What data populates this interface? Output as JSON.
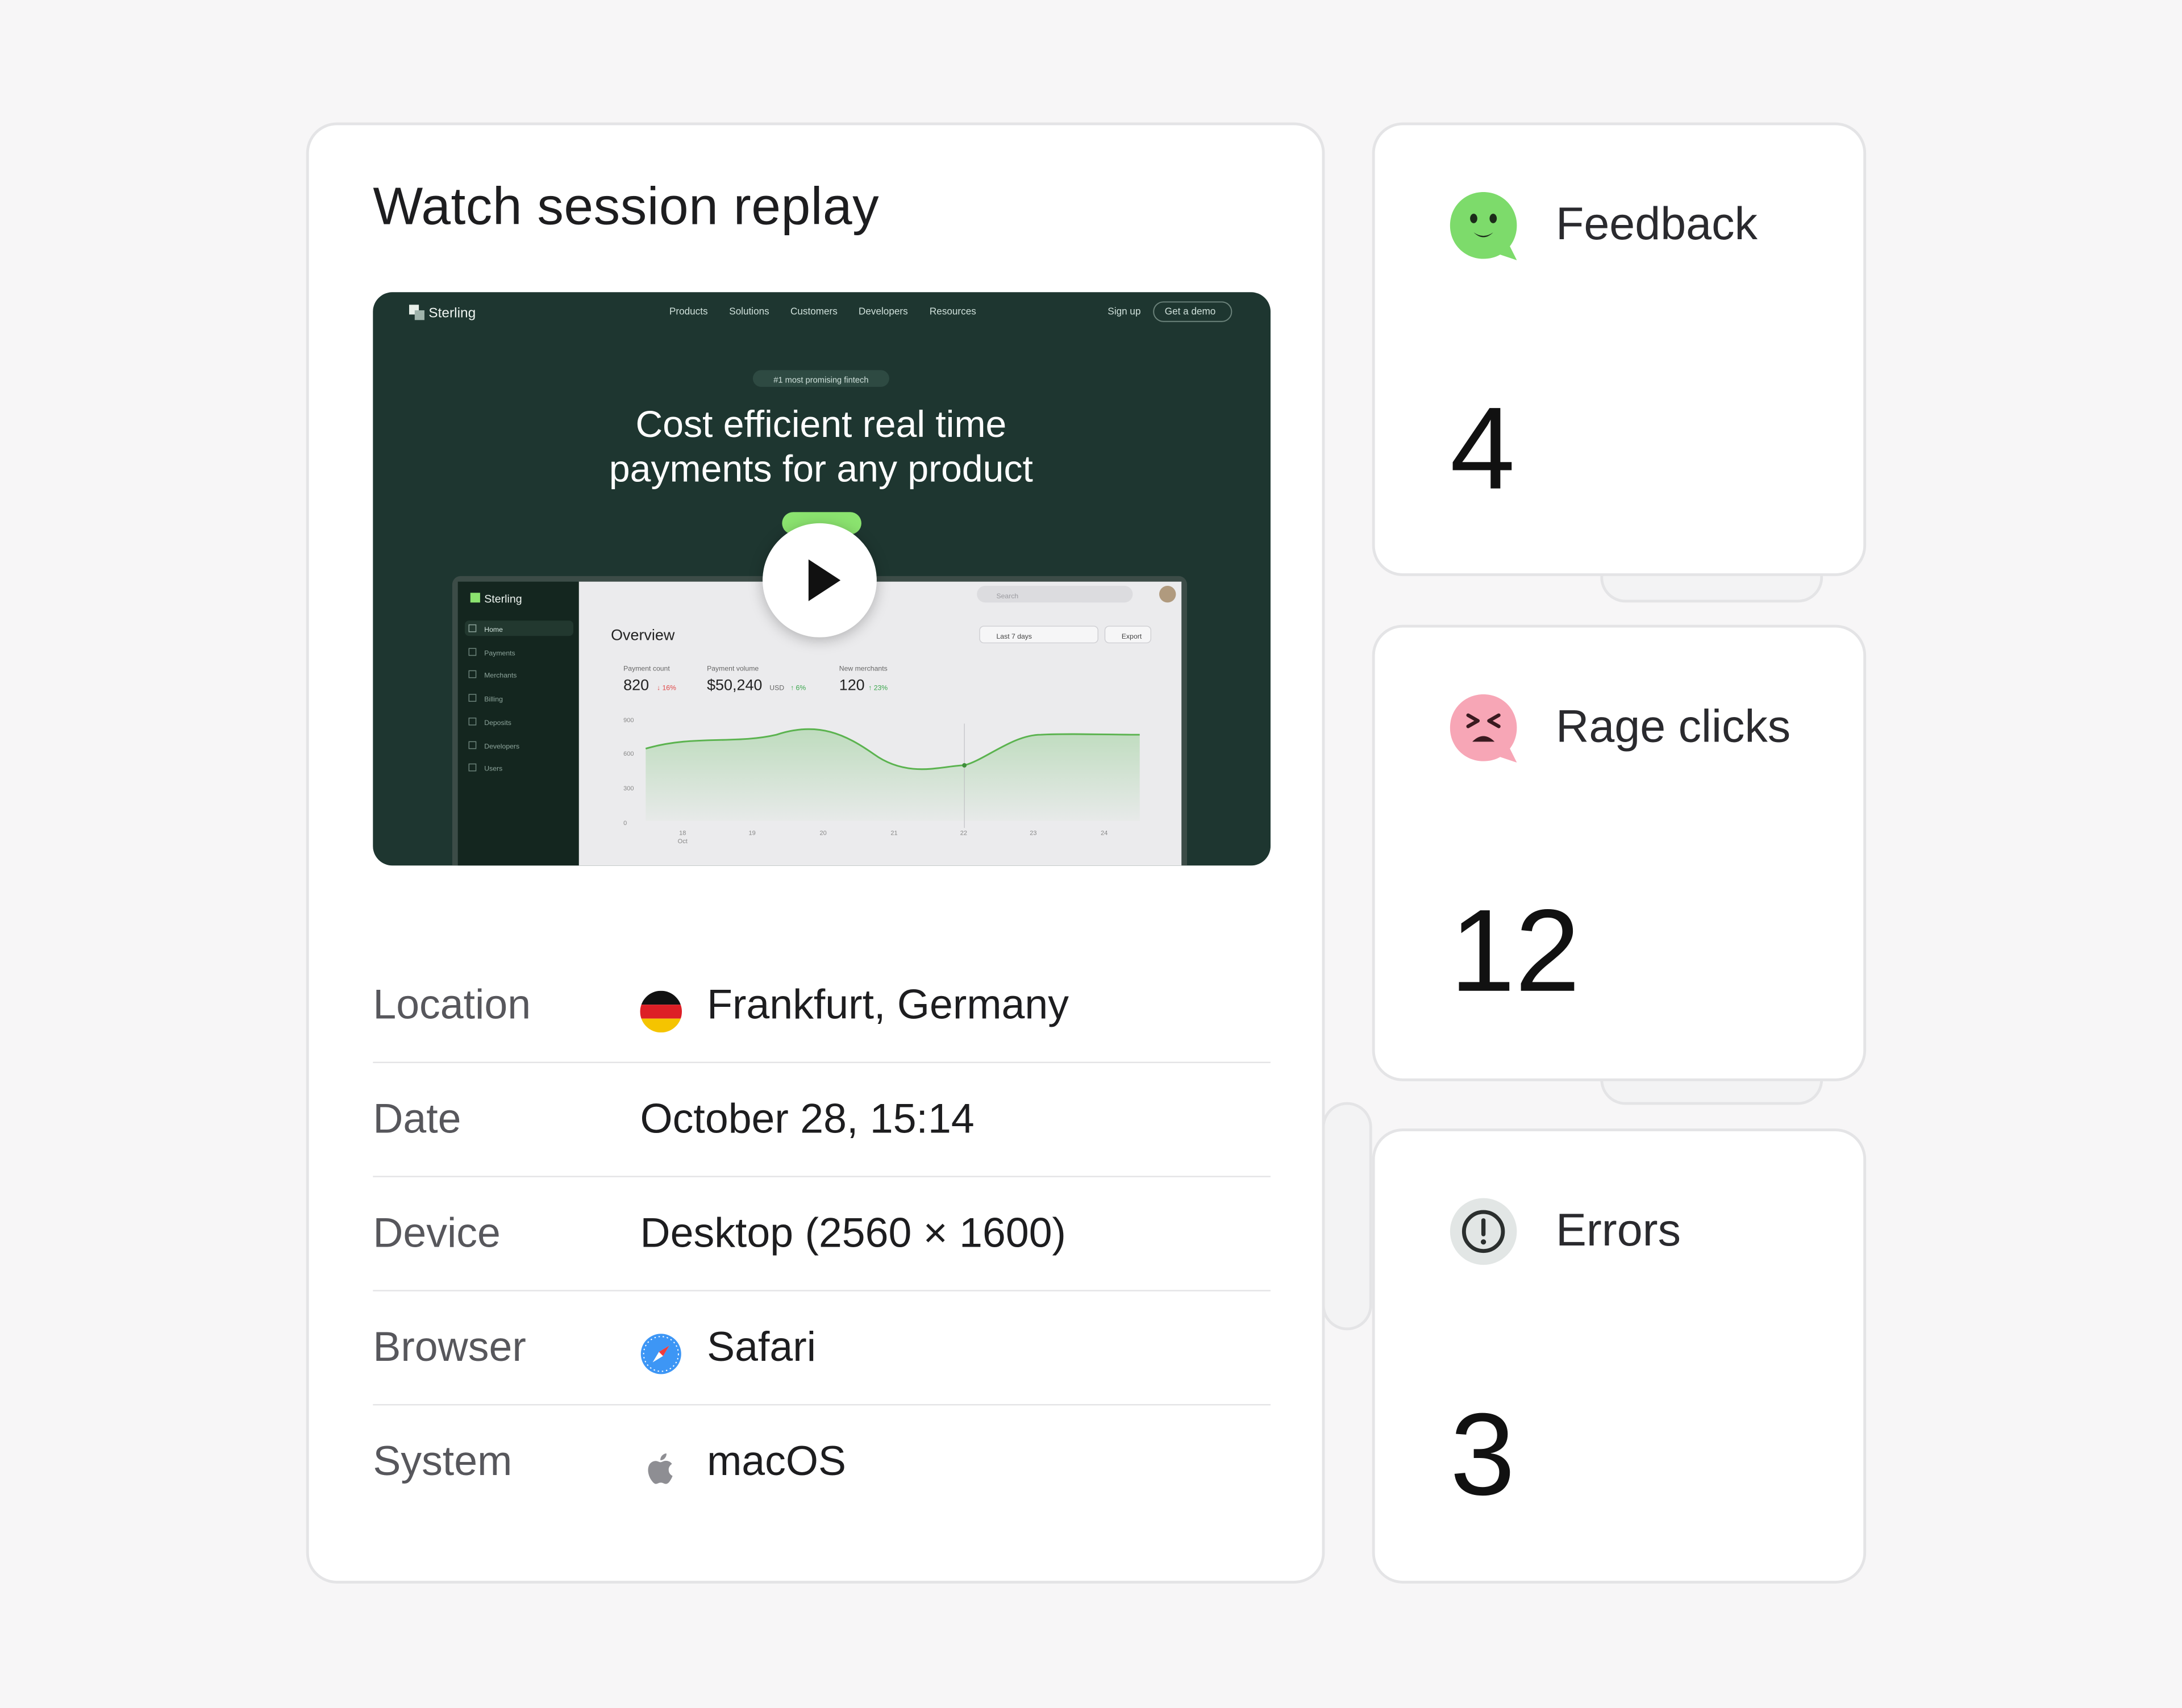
{
  "session": {
    "title": "Watch session replay",
    "replay": {
      "brand": "Sterling",
      "nav": [
        "Products",
        "Solutions",
        "Customers",
        "Developers",
        "Resources"
      ],
      "signup": "Sign up",
      "demo": "Get a demo",
      "pill": "#1 most promising fintech",
      "headline_1": "Cost efficient real time",
      "headline_2": "payments for any product",
      "dashboard": {
        "brand": "Sterling",
        "sidebar": [
          "Home",
          "Payments",
          "Merchants",
          "Billing",
          "Deposits",
          "Developers",
          "Users"
        ],
        "search_placeholder": "Search",
        "title": "Overview",
        "range": "Last 7 days",
        "export": "Export",
        "stats": [
          {
            "label": "Payment count",
            "value": "820",
            "delta": "↓ 16%"
          },
          {
            "label": "Payment volume",
            "value": "$50,240",
            "unit": "USD",
            "delta": "↑ 6%"
          },
          {
            "label": "New merchants",
            "value": "120",
            "delta": "↑ 23%"
          }
        ],
        "y_ticks": [
          "900",
          "600",
          "300",
          "0"
        ],
        "x_ticks": [
          "18",
          "19",
          "20",
          "21",
          "22",
          "23",
          "24"
        ],
        "x_month": "Oct"
      }
    },
    "info": [
      {
        "label": "Location",
        "value": "Frankfurt, Germany",
        "icon": "germany-flag-icon"
      },
      {
        "label": "Date",
        "value": "October 28, 15:14"
      },
      {
        "label": "Device",
        "value": "Desktop (2560 × 1600)"
      },
      {
        "label": "Browser",
        "value": "Safari",
        "icon": "safari-icon"
      },
      {
        "label": "System",
        "value": "macOS",
        "icon": "apple-icon"
      }
    ]
  },
  "metrics": [
    {
      "title": "Feedback",
      "value": "4",
      "icon": "happy-face-icon",
      "color": "#7ddb6b"
    },
    {
      "title": "Rage clicks",
      "value": "12",
      "icon": "angry-face-icon",
      "color": "#f7a6b6"
    },
    {
      "title": "Errors",
      "value": "3",
      "icon": "alert-circle-icon",
      "color": "#e2e6e5"
    }
  ]
}
